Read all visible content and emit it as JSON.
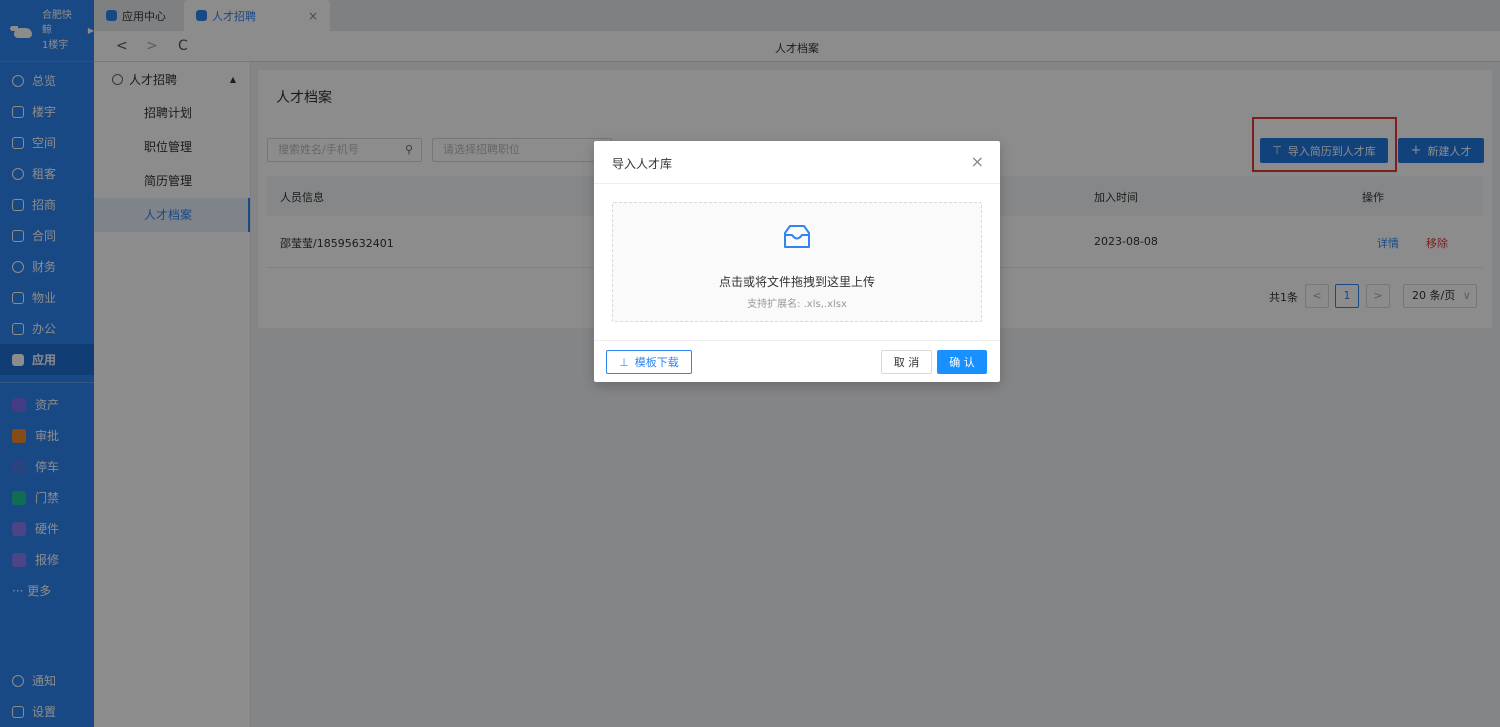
{
  "brand": {
    "name": "合肥快鲸",
    "building": "1楼宇"
  },
  "sidebar": {
    "items": [
      {
        "label": "总览",
        "icon": "dashboard-icon"
      },
      {
        "label": "楼宇",
        "icon": "building-icon"
      },
      {
        "label": "空间",
        "icon": "cube-icon"
      },
      {
        "label": "租客",
        "icon": "people-icon"
      },
      {
        "label": "招商",
        "icon": "tag-icon"
      },
      {
        "label": "合同",
        "icon": "document-icon"
      },
      {
        "label": "财务",
        "icon": "money-icon"
      },
      {
        "label": "物业",
        "icon": "home-icon"
      },
      {
        "label": "办公",
        "icon": "monitor-icon"
      },
      {
        "label": "应用",
        "icon": "app-icon",
        "active": true
      }
    ],
    "apps": [
      {
        "label": "资产",
        "color": "#7c6cf2",
        "icon": "asset-icon"
      },
      {
        "label": "审批",
        "color": "#f58a2c",
        "icon": "approval-icon"
      },
      {
        "label": "停车",
        "color": "#4b7bec",
        "icon": "parking-icon"
      },
      {
        "label": "门禁",
        "color": "#21c39a",
        "icon": "access-icon"
      },
      {
        "label": "硬件",
        "color": "#8b7cf6",
        "icon": "hardware-icon"
      },
      {
        "label": "报修",
        "color": "#8b7cf6",
        "icon": "repair-icon"
      }
    ],
    "more_label": "··· 更多",
    "bottom": [
      {
        "label": "通知",
        "icon": "bell-icon"
      },
      {
        "label": "设置",
        "icon": "menu-icon"
      }
    ]
  },
  "tabs": [
    {
      "label": "应用中心"
    },
    {
      "label": "人才招聘",
      "active": true,
      "close": "×"
    }
  ],
  "address": {
    "title": "人才档案",
    "back": "<",
    "forward": ">",
    "refresh": "C"
  },
  "submenu": {
    "head": "人才招聘",
    "items": [
      "招聘计划",
      "职位管理",
      "简历管理",
      "人才档案"
    ]
  },
  "main": {
    "title": "人才档案",
    "search_placeholder": "搜索姓名/手机号",
    "position_placeholder": "请选择招聘职位",
    "import_button": "导入简历到人才库",
    "new_button": "新建人才",
    "columns": {
      "info": "人员信息",
      "joined": "加入时间",
      "actions": "操作"
    },
    "rows": [
      {
        "info": "邵莹莹/18595632401",
        "joined": "2023-08-08",
        "detail": "详情",
        "remove": "移除"
      }
    ],
    "pager": {
      "total": "共1条",
      "page": "1",
      "prev": "<",
      "next": ">",
      "size": "20 条/页"
    }
  },
  "modal": {
    "title": "导入人才库",
    "close": "×",
    "drop_text": "点击或将文件拖拽到这里上传",
    "hint": "支持扩展名: .xls,.xlsx",
    "template_button": "模板下载",
    "cancel_button": "取 消",
    "ok_button": "确 认"
  }
}
